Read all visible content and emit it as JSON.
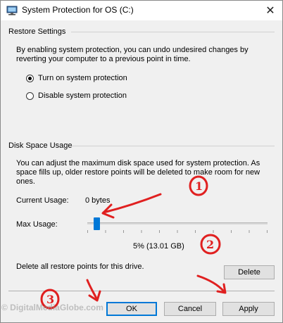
{
  "window": {
    "title": "System Protection for OS (C:)"
  },
  "restore_settings": {
    "heading": "Restore Settings",
    "description_line1": "By enabling system protection, you can undo undesired changes by",
    "description_line2": "reverting your computer to a previous point in time.",
    "options": [
      {
        "label": "Turn on system protection",
        "checked": true
      },
      {
        "label": "Disable system protection",
        "checked": false
      }
    ]
  },
  "disk_space": {
    "heading": "Disk Space Usage",
    "description_line1": "You can adjust the maximum disk space used for system protection. As",
    "description_line2": "space fills up, older restore points will be deleted to make room for new",
    "description_line3": "ones.",
    "current_usage_label": "Current Usage:",
    "current_usage_value": "0 bytes",
    "max_usage_label": "Max Usage:",
    "max_usage_percent": 5,
    "max_usage_text": "5% (13.01 GB)",
    "delete_text": "Delete all restore points for this drive.",
    "delete_button": "Delete"
  },
  "footer": {
    "ok_label": "OK",
    "cancel_label": "Cancel",
    "apply_label": "Apply"
  },
  "annotations": {
    "color": "#e02020",
    "marker_1": "1",
    "marker_2": "2",
    "marker_3": "3"
  },
  "watermark": "© DigitalMediaGlobe.com",
  "icons": {
    "title": "system-protection-icon",
    "close": "close-icon"
  }
}
